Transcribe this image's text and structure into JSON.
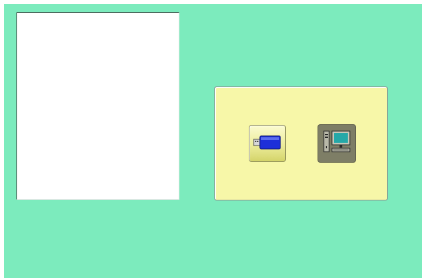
{
  "colors": {
    "screen_background": "#7cebbd",
    "preview_background": "#ffffff",
    "source_panel_background": "#f7f7a8",
    "usb_button_background": "#ecec9a",
    "pc_button_background": "#7e7e66"
  },
  "source_panel": {
    "buttons": [
      {
        "icon": "usb-drive-icon",
        "state": "normal"
      },
      {
        "icon": "computer-icon",
        "state": "selected"
      }
    ]
  }
}
